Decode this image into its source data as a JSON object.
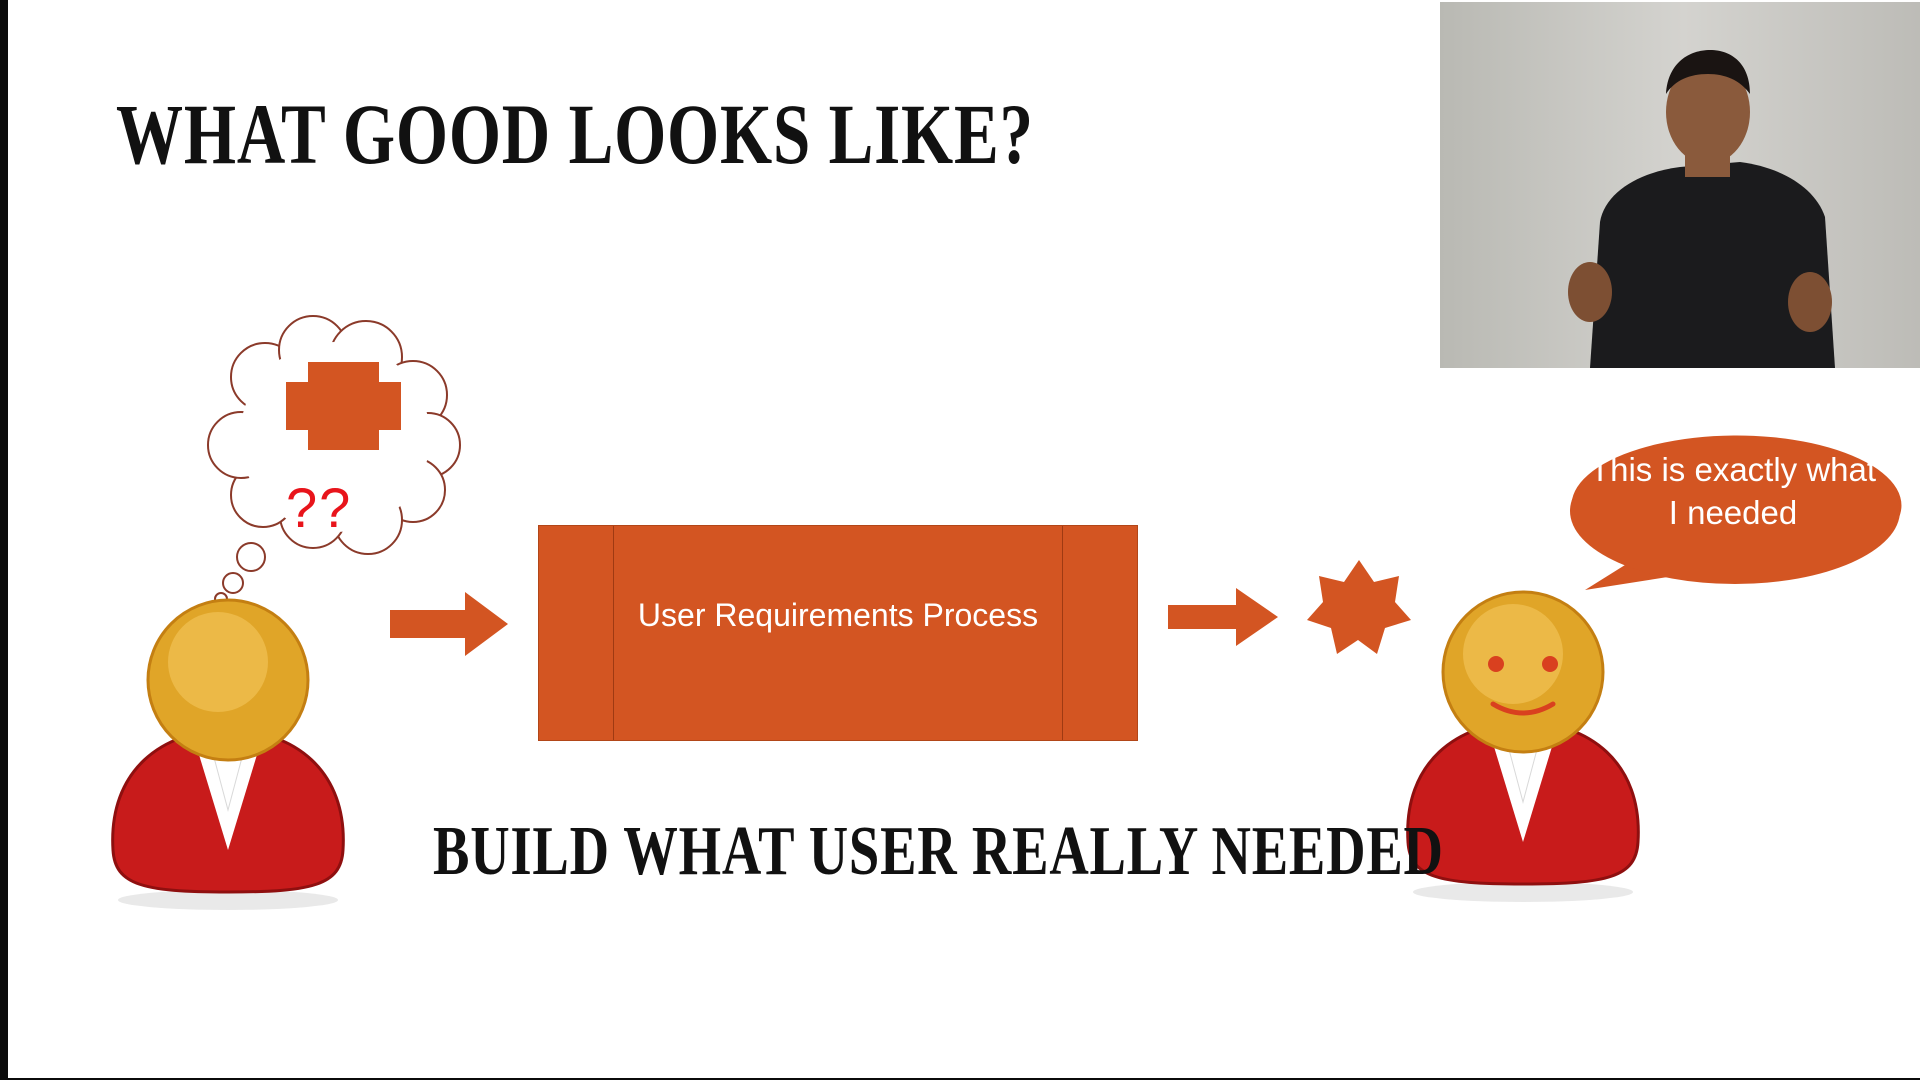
{
  "slide": {
    "title": "WHAT GOOD LOOKS LIKE?",
    "subtitle": "BUILD WHAT USER REALLY NEEDED",
    "process_label": "User Requirements Process",
    "thought_text": "??",
    "speech_text": "This is exactly what I needed"
  },
  "colors": {
    "accent": "#d35522",
    "person_body": "#c81b1b",
    "person_head": "#e0a528",
    "question_marks": "#e8141b"
  },
  "icons": [
    "thought-cloud-icon",
    "cross-icon",
    "user-icon",
    "arrow-right-icon",
    "star-icon",
    "happy-user-icon",
    "speech-bubble-icon"
  ]
}
